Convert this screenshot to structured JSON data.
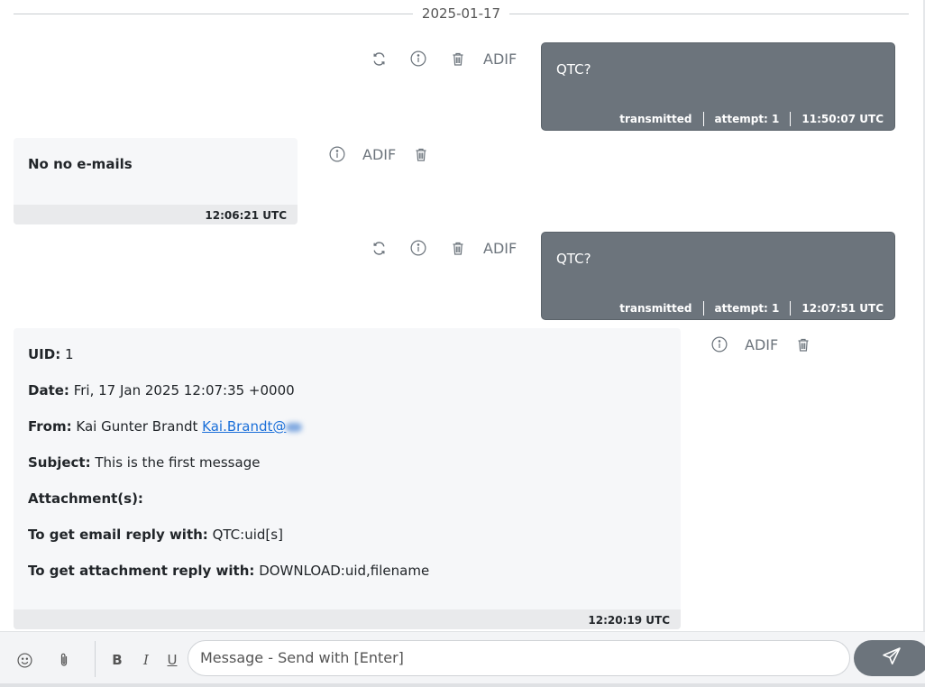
{
  "date_separator": "2025-01-17",
  "messages": [
    {
      "text": "QTC?",
      "status": "transmitted",
      "attempt": "attempt: 1",
      "time": "11:50:07 UTC",
      "adif_label": "ADIF"
    },
    {
      "text": "No no e-mails",
      "time": "12:06:21 UTC",
      "adif_label": "ADIF"
    },
    {
      "text": "QTC?",
      "status": "transmitted",
      "attempt": "attempt: 1",
      "time": "12:07:51 UTC",
      "adif_label": "ADIF"
    },
    {
      "uid_label": "UID:",
      "uid_value": "1",
      "date_label": "Date:",
      "date_value": "Fri, 17 Jan 2025 12:07:35 +0000",
      "from_label": "From:",
      "from_name": "Kai Gunter Brandt",
      "from_email": "Kai.Brandt@",
      "subject_label": "Subject:",
      "subject_value": "This is the first message",
      "attachments_label": "Attachment(s):",
      "reply_email_label": "To get email reply with:",
      "reply_email_value": "QTC:uid[s]",
      "reply_attach_label": "To get attachment reply with:",
      "reply_attach_value": "DOWNLOAD:uid,filename",
      "time": "12:20:19 UTC",
      "adif_label": "ADIF"
    }
  ],
  "composer": {
    "placeholder": "Message - Send with [Enter]",
    "bold": "B",
    "italic": "I",
    "underline": "U"
  },
  "icons": {
    "resend": "refresh-icon",
    "info": "info-icon",
    "delete": "trash-icon",
    "emoji": "smile-icon",
    "attach": "paperclip-icon",
    "send": "send-icon"
  },
  "colors": {
    "outgoing_bubble": "#6c747c",
    "incoming_bubble": "#f6f7f9",
    "link": "#1a6fd9"
  }
}
